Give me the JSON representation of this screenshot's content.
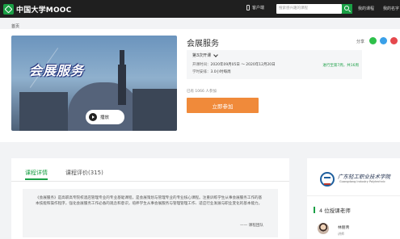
{
  "colors": {
    "brand_green": "#1a9f45",
    "join_orange": "#f08a3a",
    "topbar": "#1f1f1f"
  },
  "header": {
    "logo_text": "中国大学MOOC",
    "app_label": "客户端",
    "search_placeholder": "搜索感兴趣的课程",
    "my_courses": "我的课程",
    "my_name": "我的名字"
  },
  "breadcrumb": "首页",
  "course": {
    "cover_title": "会展服务",
    "play_label": "播放",
    "title": "会展服务",
    "share_label": "分享",
    "session_label": "第3次开课",
    "time_label": "开课时间：",
    "time_value": "2020年09月05日 ～ 2020年12月20日",
    "workload_label": "学时安排：",
    "workload_value": "3.0小时每周",
    "progress": "进行至第7周，共16周",
    "enrolled": "已有 1066 人参加",
    "join_button": "立即参加"
  },
  "tabs": {
    "details": "课程详情",
    "reviews": "课程评价(315)"
  },
  "intro": {
    "text": "《会展服务》是高职高专院校酒店管理专业的专业基础课程，是会展策划与管理专业的专业核心课程。注重训练学生从事会展服务工作的基本技能和操作程序，强化会展服务工作必备的观念和意识，培养学生从事会展服务与管理管理工作、适应行业发展与职业变化的基本能力。",
    "signature": "—— 课程团队"
  },
  "school": {
    "name": "广东轻工职业技术学院",
    "name_en": "Guangdong Industry Polytechnic"
  },
  "teachers": {
    "heading": "4 位授课老师",
    "items": [
      {
        "name": "林丽青",
        "role": "讲师"
      }
    ]
  },
  "icons": [
    "play-icon",
    "search-icon",
    "phone-icon",
    "wechat-icon",
    "qq-icon",
    "weibo-icon",
    "chevron-down-icon"
  ]
}
